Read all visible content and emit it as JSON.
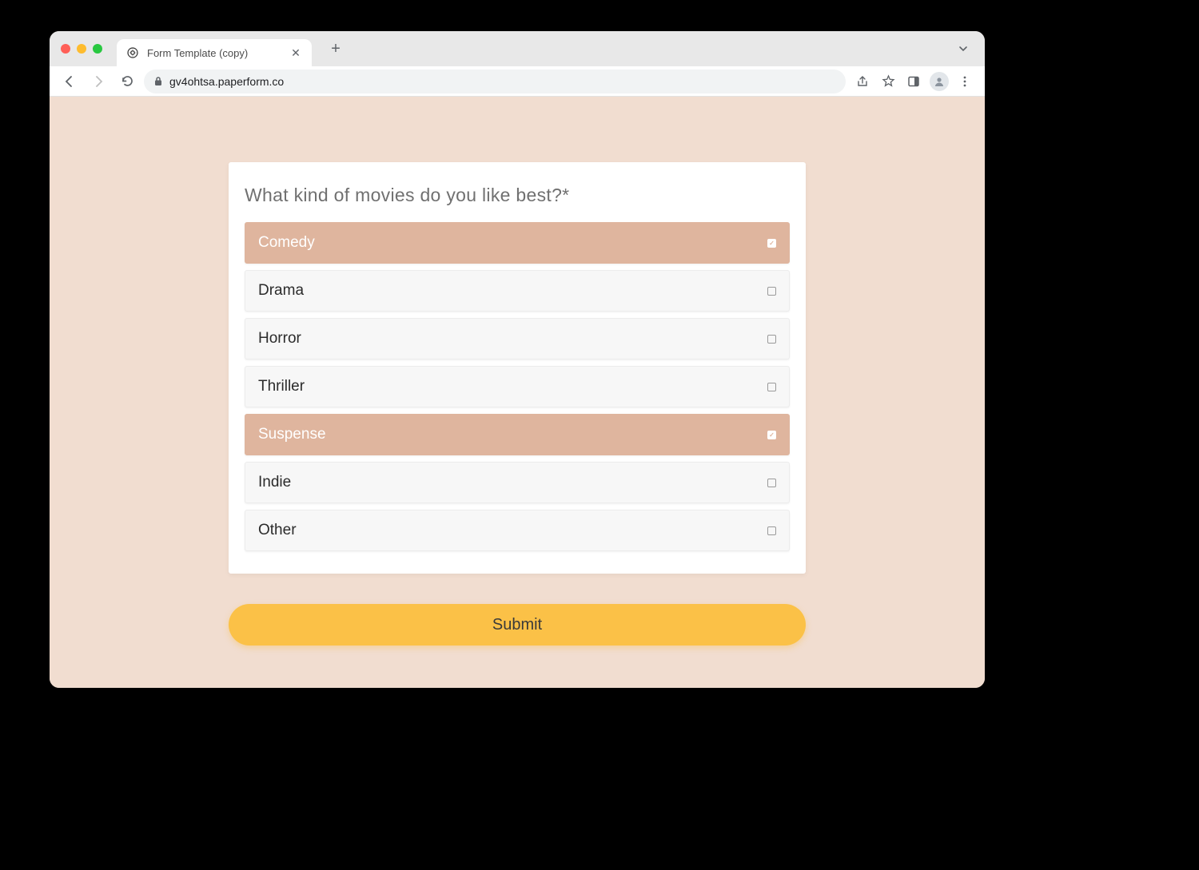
{
  "browser": {
    "tab_title": "Form Template (copy)",
    "url": "gv4ohtsa.paperform.co"
  },
  "form": {
    "question": "What kind of movies do you like best?*",
    "options": [
      {
        "label": "Comedy",
        "selected": true
      },
      {
        "label": "Drama",
        "selected": false
      },
      {
        "label": "Horror",
        "selected": false
      },
      {
        "label": "Thriller",
        "selected": false
      },
      {
        "label": "Suspense",
        "selected": true
      },
      {
        "label": "Indie",
        "selected": false
      },
      {
        "label": "Other",
        "selected": false
      }
    ],
    "submit_label": "Submit"
  },
  "colors": {
    "page_bg": "#f1ddd0",
    "selected_bg": "#dfb59e",
    "submit_bg": "#fbc147"
  }
}
